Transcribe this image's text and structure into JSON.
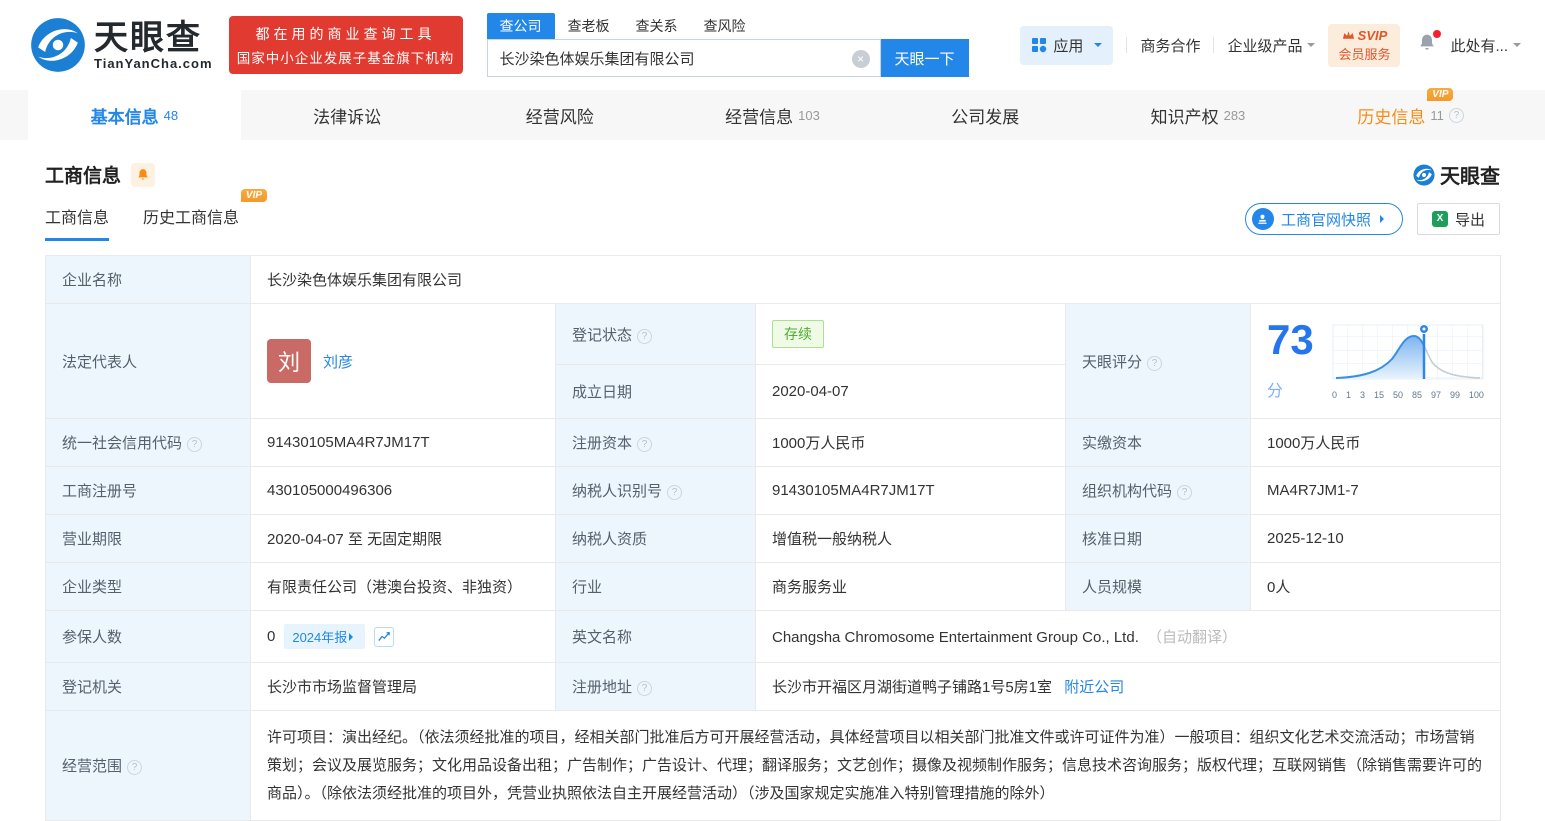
{
  "colors": {
    "accent": "#2287e8",
    "banner_red": "#e13a30",
    "vip_orange": "#f5992a",
    "status_green": "#4caf2e",
    "score_blue": "#2576ec",
    "label_bg": "#edf6fc"
  },
  "icons": {
    "question": "?",
    "clear": "×",
    "excel": "X"
  },
  "header": {
    "logo": {
      "title": "天眼查",
      "subtitle": "TianYanCha.com"
    },
    "banner": {
      "line1": "都在用的商业查询工具",
      "line2": "国家中小企业发展子基金旗下机构"
    },
    "search": {
      "tabs": [
        {
          "label": "查公司"
        },
        {
          "label": "查老板"
        },
        {
          "label": "查关系"
        },
        {
          "label": "查风险"
        }
      ],
      "value": "长沙染色体娱乐集团有限公司",
      "button": "天眼一下"
    },
    "nav": {
      "apps": "应用",
      "cooperation": "商务合作",
      "enterprise": "企业级产品",
      "svip_top": "SVIP",
      "svip_bottom": "会员服务",
      "user": "此处有..."
    }
  },
  "tabs": [
    {
      "label": "基本信息",
      "count": "48"
    },
    {
      "label": "法律诉讼",
      "count": ""
    },
    {
      "label": "经营风险",
      "count": ""
    },
    {
      "label": "经营信息",
      "count": "103"
    },
    {
      "label": "公司发展",
      "count": ""
    },
    {
      "label": "知识产权",
      "count": "283"
    },
    {
      "label": "历史信息",
      "count": "11"
    }
  ],
  "section": {
    "title": "工商信息",
    "watermark": "天眼查",
    "subtabs": [
      {
        "label": "工商信息"
      },
      {
        "label": "历史工商信息"
      }
    ],
    "snapshot_button": "工商官网快照",
    "export_button": "导出",
    "vip_badge": "VIP"
  },
  "score_chart": {
    "score": "73",
    "unit": "分",
    "ticks": [
      "0",
      "1",
      "3",
      "15",
      "50",
      "85",
      "97",
      "99",
      "100"
    ]
  },
  "table": {
    "name": {
      "label": "企业名称",
      "value": "长沙染色体娱乐集团有限公司"
    },
    "legal": {
      "label": "法定代表人",
      "avatar": "刘",
      "name": "刘彦"
    },
    "status": {
      "label": "登记状态",
      "value": "存续"
    },
    "founded": {
      "label": "成立日期",
      "value": "2020-04-07"
    },
    "score": {
      "label": "天眼评分"
    },
    "uscc": {
      "label": "统一社会信用代码",
      "value": "91430105MA4R7JM17T"
    },
    "reg_capital": {
      "label": "注册资本",
      "value": "1000万人民币"
    },
    "paid_capital": {
      "label": "实缴资本",
      "value": "1000万人民币"
    },
    "reg_no": {
      "label": "工商注册号",
      "value": "430105000496306"
    },
    "tax_id": {
      "label": "纳税人识别号",
      "value": "91430105MA4R7JM17T"
    },
    "org_code": {
      "label": "组织机构代码",
      "value": "MA4R7JM1-7"
    },
    "term": {
      "label": "营业期限",
      "value": "2020-04-07 至 无固定期限"
    },
    "tax_qual": {
      "label": "纳税人资质",
      "value": "增值税一般纳税人"
    },
    "approval_date": {
      "label": "核准日期",
      "value": "2025-12-10"
    },
    "company_type": {
      "label": "企业类型",
      "value": "有限责任公司（港澳台投资、非独资）"
    },
    "industry": {
      "label": "行业",
      "value": "商务服务业"
    },
    "staff_size": {
      "label": "人员规模",
      "value": "0人"
    },
    "insured": {
      "label": "参保人数",
      "value": "0",
      "report_badge": "2024年报"
    },
    "english_name": {
      "label": "英文名称",
      "value": "Changsha Chromosome Entertainment Group Co., Ltd.",
      "note": "（自动翻译）"
    },
    "reg_authority": {
      "label": "登记机关",
      "value": "长沙市市场监督管理局"
    },
    "address": {
      "label": "注册地址",
      "value": "长沙市开福区月湖街道鸭子铺路1号5房1室",
      "nearby_link": "附近公司"
    },
    "business_scope": {
      "label": "经营范围",
      "value": "许可项目：演出经纪。（依法须经批准的项目，经相关部门批准后方可开展经营活动，具体经营项目以相关部门批准文件或许可证件为准）一般项目：组织文化艺术交流活动；市场营销策划；会议及展览服务；文化用品设备出租；广告制作；广告设计、代理；翻译服务；文艺创作；摄像及视频制作服务；信息技术咨询服务；版权代理；互联网销售（除销售需要许可的商品）。（除依法须经批准的项目外，凭营业执照依法自主开展经营活动）（涉及国家规定实施准入特别管理措施的除外）"
    }
  }
}
